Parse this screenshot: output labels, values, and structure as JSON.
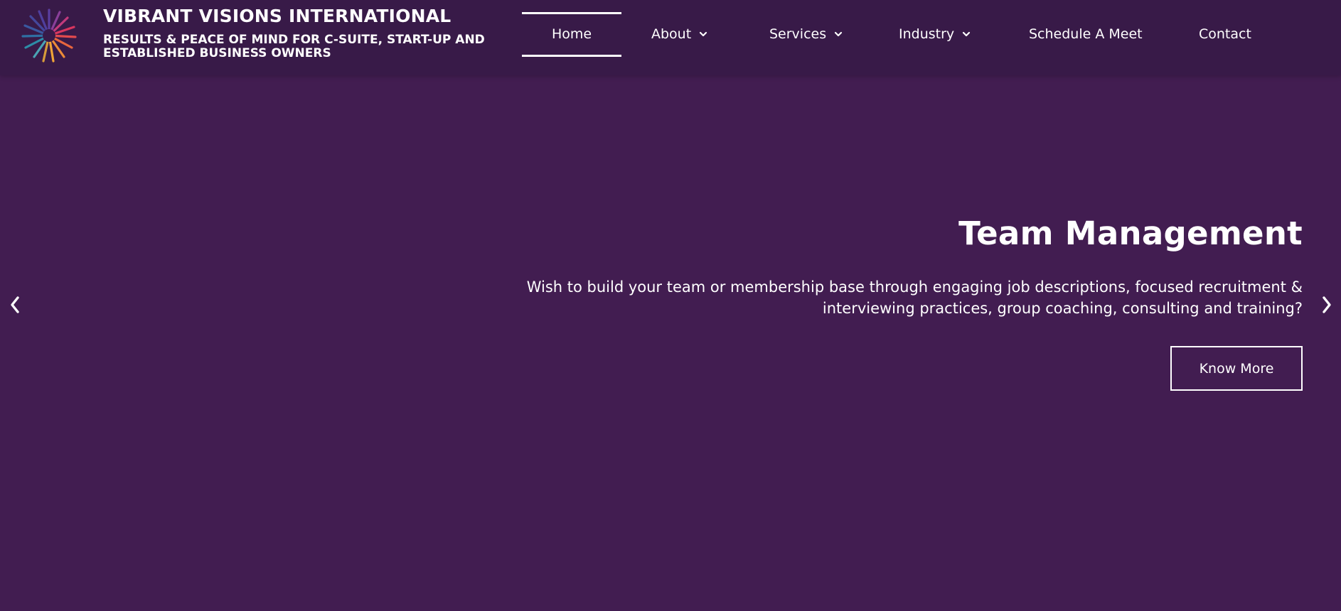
{
  "header": {
    "brand_title": "VIBRANT VISIONS INTERNATIONAL",
    "brand_tagline": "RESULTS & PEACE OF MIND FOR C-SUITE, START-UP AND ESTABLISHED BUSINESS OWNERS",
    "logo_icon": "starburst-logo-icon"
  },
  "nav": {
    "items": [
      {
        "label": "Home",
        "active": true,
        "has_dropdown": false
      },
      {
        "label": "About",
        "active": false,
        "has_dropdown": true
      },
      {
        "label": "Services",
        "active": false,
        "has_dropdown": true
      },
      {
        "label": "Industry",
        "active": false,
        "has_dropdown": true
      },
      {
        "label": "Schedule A Meet",
        "active": false,
        "has_dropdown": false
      },
      {
        "label": "Contact",
        "active": false,
        "has_dropdown": false
      }
    ]
  },
  "hero": {
    "title": "Team Management",
    "description": "Wish to build your team or membership base through engaging job descriptions, focused recruitment & interviewing practices, group coaching, consulting and training?",
    "cta_label": "Know More"
  },
  "slider": {
    "prev_icon": "chevron-left-icon",
    "next_icon": "chevron-right-icon"
  },
  "colors": {
    "header_bg": "#381a48",
    "hero_bg": "#421d51",
    "text": "#ffffff"
  }
}
